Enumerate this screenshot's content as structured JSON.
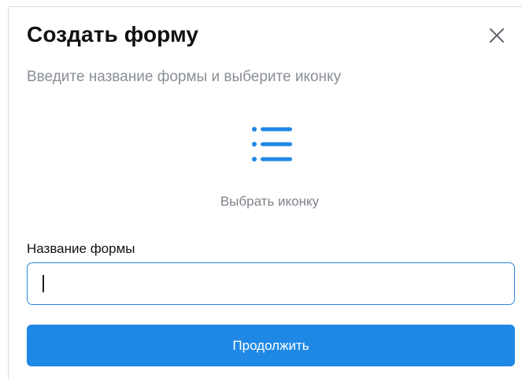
{
  "dialog": {
    "title": "Создать форму",
    "subtitle": "Введите название формы и выберите иконку",
    "close_icon": "close-icon",
    "icon_picker": {
      "icon": "list-icon",
      "label": "Выбрать иконку",
      "color": "#1f88e5"
    },
    "name_field": {
      "label": "Название формы",
      "value": "",
      "placeholder": ""
    },
    "continue_label": "Продолжить",
    "accent_color": "#1f88e5"
  }
}
